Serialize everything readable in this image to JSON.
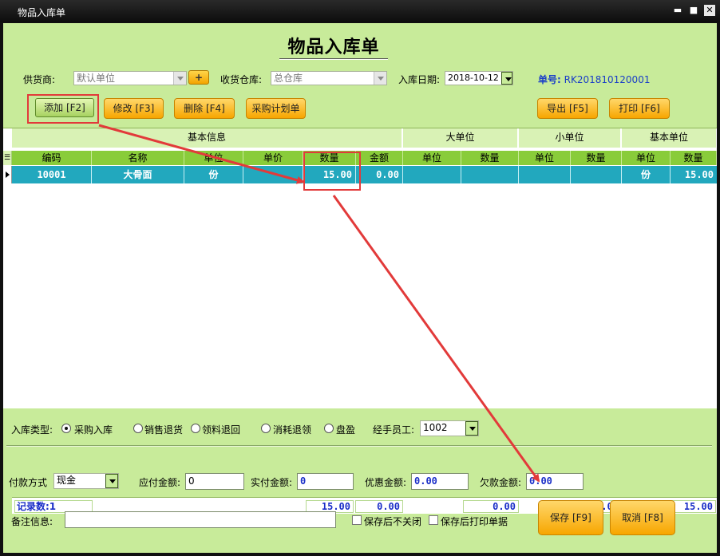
{
  "window": {
    "title": "物品入库单",
    "min": "▬",
    "max": "■",
    "close": "✕"
  },
  "heading": "物品入库单",
  "form": {
    "supplier_label": "供货商:",
    "supplier_value": "默认单位",
    "plus": "+",
    "warehouse_label": "收货仓库:",
    "warehouse_value": "总仓库",
    "date_label": "入库日期:",
    "date_value": "2018-10-12",
    "order_label": "单号:",
    "order_value": "RK201810120001"
  },
  "toolbar": {
    "add": "添加 [F2]",
    "edit": "修改 [F3]",
    "delete": "删除 [F4]",
    "purchase_plan": "采购计划单",
    "export": "导出 [F5]",
    "print": "打印 [F6]"
  },
  "grid": {
    "groups": [
      "基本信息",
      "大单位",
      "小单位",
      "基本单位"
    ],
    "columns": [
      "编码",
      "名称",
      "单位",
      "单价",
      "数量",
      "金额",
      "单位",
      "数量",
      "单位",
      "数量",
      "单位",
      "数量"
    ],
    "rows": [
      [
        "10001",
        "大骨面",
        "份",
        "",
        "15.00",
        "0.00",
        "",
        "",
        "",
        "",
        "份",
        "15.00"
      ]
    ],
    "footer": {
      "record_count": "记录数:1",
      "qty_total": "15.00",
      "amount_total": "0.00",
      "big_total": "0.00",
      "small_total": "0.00",
      "base_total": "15.00"
    }
  },
  "inbound_type": {
    "label": "入库类型:",
    "options": [
      "采购入库",
      "销售退货",
      "领料退回",
      "消耗退领",
      "盘盈"
    ],
    "selected": 0,
    "handler_label": "经手员工:",
    "handler_value": "1002"
  },
  "payment": {
    "method_label": "付款方式",
    "method_value": "现金",
    "payable_label": "应付金额:",
    "payable_value": "0",
    "paid_label": "实付金额:",
    "paid_value": "0",
    "discount_label": "优惠金额:",
    "discount_value": "0.00",
    "owed_label": "欠款金额:",
    "owed_value": "0.00"
  },
  "remarks": {
    "label": "备注信息:",
    "value": ""
  },
  "options": {
    "no_close": "保存后不关闭",
    "print_after": "保存后打印单据"
  },
  "actions": {
    "save": "保存 [F9]",
    "cancel": "取消 [F8]"
  },
  "colors": {
    "annotation": "#e23a3a",
    "row_selected": "#22a8be",
    "panel": "#c8eb9a"
  }
}
